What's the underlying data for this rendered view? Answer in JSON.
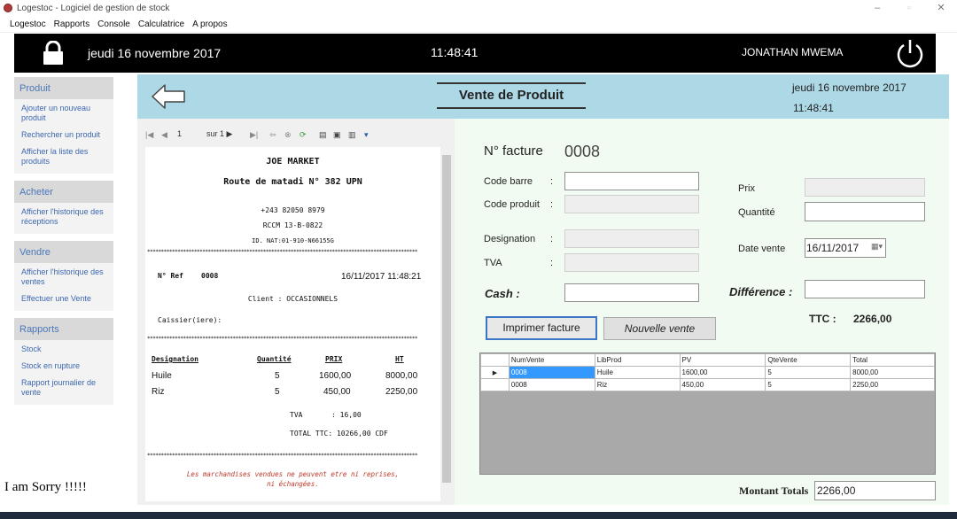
{
  "window": {
    "title": "Logestoc - Logiciel de gestion de stock"
  },
  "menu": [
    "Logestoc",
    "Rapports",
    "Console",
    "Calculatrice",
    "A propos"
  ],
  "topbar": {
    "date": "jeudi 16 novembre 2017",
    "time": "11:48:41",
    "user": "JONATHAN MWEMA"
  },
  "sidebar": {
    "groups": [
      {
        "title": "Produit",
        "items": [
          "Ajouter un nouveau produit",
          "Rechercher un produit",
          "Afficher la liste des produits"
        ]
      },
      {
        "title": "Acheter",
        "items": [
          "Afficher l'historique des réceptions"
        ]
      },
      {
        "title": "Vendre",
        "items": [
          "Afficher l'historique des ventes",
          "Effectuer une Vente"
        ]
      },
      {
        "title": "Rapports",
        "items": [
          "Stock",
          "Stock en rupture",
          "Rapport journalier de vente"
        ]
      }
    ]
  },
  "footer_note": "I am Sorry !!!!!",
  "header": {
    "title": "Vente de Produit",
    "date": "jeudi 16 novembre 2017",
    "time": "11:48:41"
  },
  "report_toolbar": {
    "page": "1",
    "of": "sur 1 ▶"
  },
  "receipt": {
    "shop": "JOE MARKET",
    "address": "Route de matadi N° 382 UPN",
    "phone": "+243 82050 8979",
    "rccm": "RCCM 13-B-0822",
    "idnat": "ID. NAT:01-910-N66155G",
    "stars": "**************************************************************************************************",
    "ref_label": "N° Ref",
    "ref": "0008",
    "datetime": "16/11/2017 11:48:21",
    "client": "Client : OCCASIONNELS",
    "cashier": "Caissier(iere):",
    "columns": [
      "Designation",
      "Quantité",
      "PRIX",
      "HT"
    ],
    "rows": [
      [
        "Huile",
        "5",
        "1600,00",
        "8000,00"
      ],
      [
        "Riz",
        "5",
        "450,00",
        "2250,00"
      ]
    ],
    "tva_label": "TVA",
    "tva": ": 16,00",
    "total": "TOTAL TTC: 10266,00 CDF",
    "notice1": "Les marchandises vendues ne peuvent etre ni reprises,",
    "notice2": "ni échangées."
  },
  "form": {
    "facture_label": "N° facture",
    "facture_num": "0008",
    "code_barre_label": "Code barre",
    "code_produit_label": "Code produit",
    "designation_label": "Designation",
    "tva_label": "TVA",
    "cash_label": "Cash :",
    "prix_label": "Prix",
    "quantite_label": "Quantité",
    "date_vente_label": "Date vente",
    "date_vente": "16/11/2017",
    "difference_label": "Différence :",
    "ttc_label": "TTC :",
    "ttc_value": "2266,00",
    "colon": ":",
    "print_button": "Imprimer facture",
    "new_button": "Nouvelle vente"
  },
  "grid": {
    "columns": [
      "NumVente",
      "LibProd",
      "PV",
      "QteVente",
      "Total"
    ],
    "rows": [
      [
        "0008",
        "Huile",
        "1600,00",
        "5",
        "8000,00"
      ],
      [
        "0008",
        "Riz",
        "450,00",
        "5",
        "2250,00"
      ]
    ]
  },
  "montant": {
    "label": "Montant Totals",
    "value": "2266,00"
  },
  "colors": {
    "header_bg": "#add8e6",
    "topbar_bg": "#000000",
    "selection": "#3399ff",
    "link": "#3b67b0"
  }
}
